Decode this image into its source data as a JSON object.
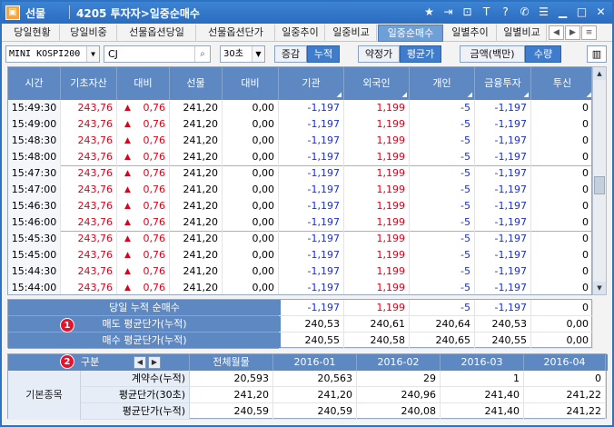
{
  "window": {
    "app_name": "선물",
    "screen_title": "4205 투자자>일중순매수",
    "icons": [
      "star-icon",
      "export-icon",
      "lock-icon",
      "text-icon",
      "help-icon",
      "phone-icon",
      "menu-icon",
      "minimize-icon",
      "maximize-icon",
      "close-icon"
    ],
    "accent_color": "#2b6cbf"
  },
  "tabs": [
    {
      "label": "당일현황",
      "active": false
    },
    {
      "label": "당일비중",
      "active": false
    },
    {
      "label": "선물옵션당일",
      "active": false
    },
    {
      "label": "선물옵션단가",
      "active": false
    },
    {
      "label": "일중추이",
      "active": false
    },
    {
      "label": "일중비교",
      "active": false
    },
    {
      "label": "일중순매수",
      "active": true
    },
    {
      "label": "일별추이",
      "active": false
    },
    {
      "label": "일별비교",
      "active": false
    }
  ],
  "toolbar": {
    "product_select": "MINI KOSPI200",
    "code_input": "CJ",
    "interval_select": "30초",
    "mode_toggle": [
      "증감",
      "누적"
    ],
    "mode_active": "누적",
    "price_toggle": [
      "약정가",
      "평균가"
    ],
    "price_active": "평균가",
    "unit_toggle": [
      "금액(백만)",
      "수량"
    ],
    "unit_active": "수량"
  },
  "grid": {
    "columns": [
      "시간",
      "기초자산",
      "대비",
      "선물",
      "대비",
      "기관",
      "외국인",
      "개인",
      "금융투자",
      "투신"
    ],
    "rows": [
      [
        "15:49:30",
        "243,76",
        "0,76",
        "241,20",
        "0,00",
        "-1,197",
        "1,199",
        "-5",
        "-1,197",
        "0"
      ],
      [
        "15:49:00",
        "243,76",
        "0,76",
        "241,20",
        "0,00",
        "-1,197",
        "1,199",
        "-5",
        "-1,197",
        "0"
      ],
      [
        "15:48:30",
        "243,76",
        "0,76",
        "241,20",
        "0,00",
        "-1,197",
        "1,199",
        "-5",
        "-1,197",
        "0"
      ],
      [
        "15:48:00",
        "243,76",
        "0,76",
        "241,20",
        "0,00",
        "-1,197",
        "1,199",
        "-5",
        "-1,197",
        "0"
      ],
      [
        "15:47:30",
        "243,76",
        "0,76",
        "241,20",
        "0,00",
        "-1,197",
        "1,199",
        "-5",
        "-1,197",
        "0"
      ],
      [
        "15:47:00",
        "243,76",
        "0,76",
        "241,20",
        "0,00",
        "-1,197",
        "1,199",
        "-5",
        "-1,197",
        "0"
      ],
      [
        "15:46:30",
        "243,76",
        "0,76",
        "241,20",
        "0,00",
        "-1,197",
        "1,199",
        "-5",
        "-1,197",
        "0"
      ],
      [
        "15:46:00",
        "243,76",
        "0,76",
        "241,20",
        "0,00",
        "-1,197",
        "1,199",
        "-5",
        "-1,197",
        "0"
      ],
      [
        "15:45:30",
        "243,76",
        "0,76",
        "241,20",
        "0,00",
        "-1,197",
        "1,199",
        "-5",
        "-1,197",
        "0"
      ],
      [
        "15:45:00",
        "243,76",
        "0,76",
        "241,20",
        "0,00",
        "-1,197",
        "1,199",
        "-5",
        "-1,197",
        "0"
      ],
      [
        "15:44:30",
        "243,76",
        "0,76",
        "241,20",
        "0,00",
        "-1,197",
        "1,199",
        "-5",
        "-1,197",
        "0"
      ],
      [
        "15:44:00",
        "243,76",
        "0,76",
        "241,20",
        "0,00",
        "-1,197",
        "1,199",
        "-5",
        "-1,197",
        "0"
      ]
    ]
  },
  "summary": {
    "badge": "1",
    "rows": [
      {
        "label": "당일 누적 순매수",
        "values": [
          "-1,197",
          "1,199",
          "-5",
          "-1,197",
          "0"
        ]
      },
      {
        "label": "매도 평균단가(누적)",
        "values": [
          "240,53",
          "240,61",
          "240,64",
          "240,53",
          "0,00"
        ]
      },
      {
        "label": "매수 평균단가(누적)",
        "values": [
          "240,55",
          "240,58",
          "240,65",
          "240,55",
          "0,00"
        ]
      }
    ]
  },
  "monthly": {
    "badge": "2",
    "header_label": "구분",
    "columns": [
      "전체월물",
      "2016-01",
      "2016-02",
      "2016-03",
      "2016-04"
    ],
    "group_label": "기본종목",
    "rows": [
      {
        "label": "계약수(누적)",
        "values": [
          "20,593",
          "20,563",
          "29",
          "1",
          "0"
        ]
      },
      {
        "label": "평균단가(30초)",
        "values": [
          "241,20",
          "241,20",
          "240,96",
          "241,40",
          "241,22"
        ]
      },
      {
        "label": "평균단가(누적)",
        "values": [
          "240,59",
          "240,59",
          "240,08",
          "241,40",
          "241,22"
        ]
      }
    ]
  }
}
